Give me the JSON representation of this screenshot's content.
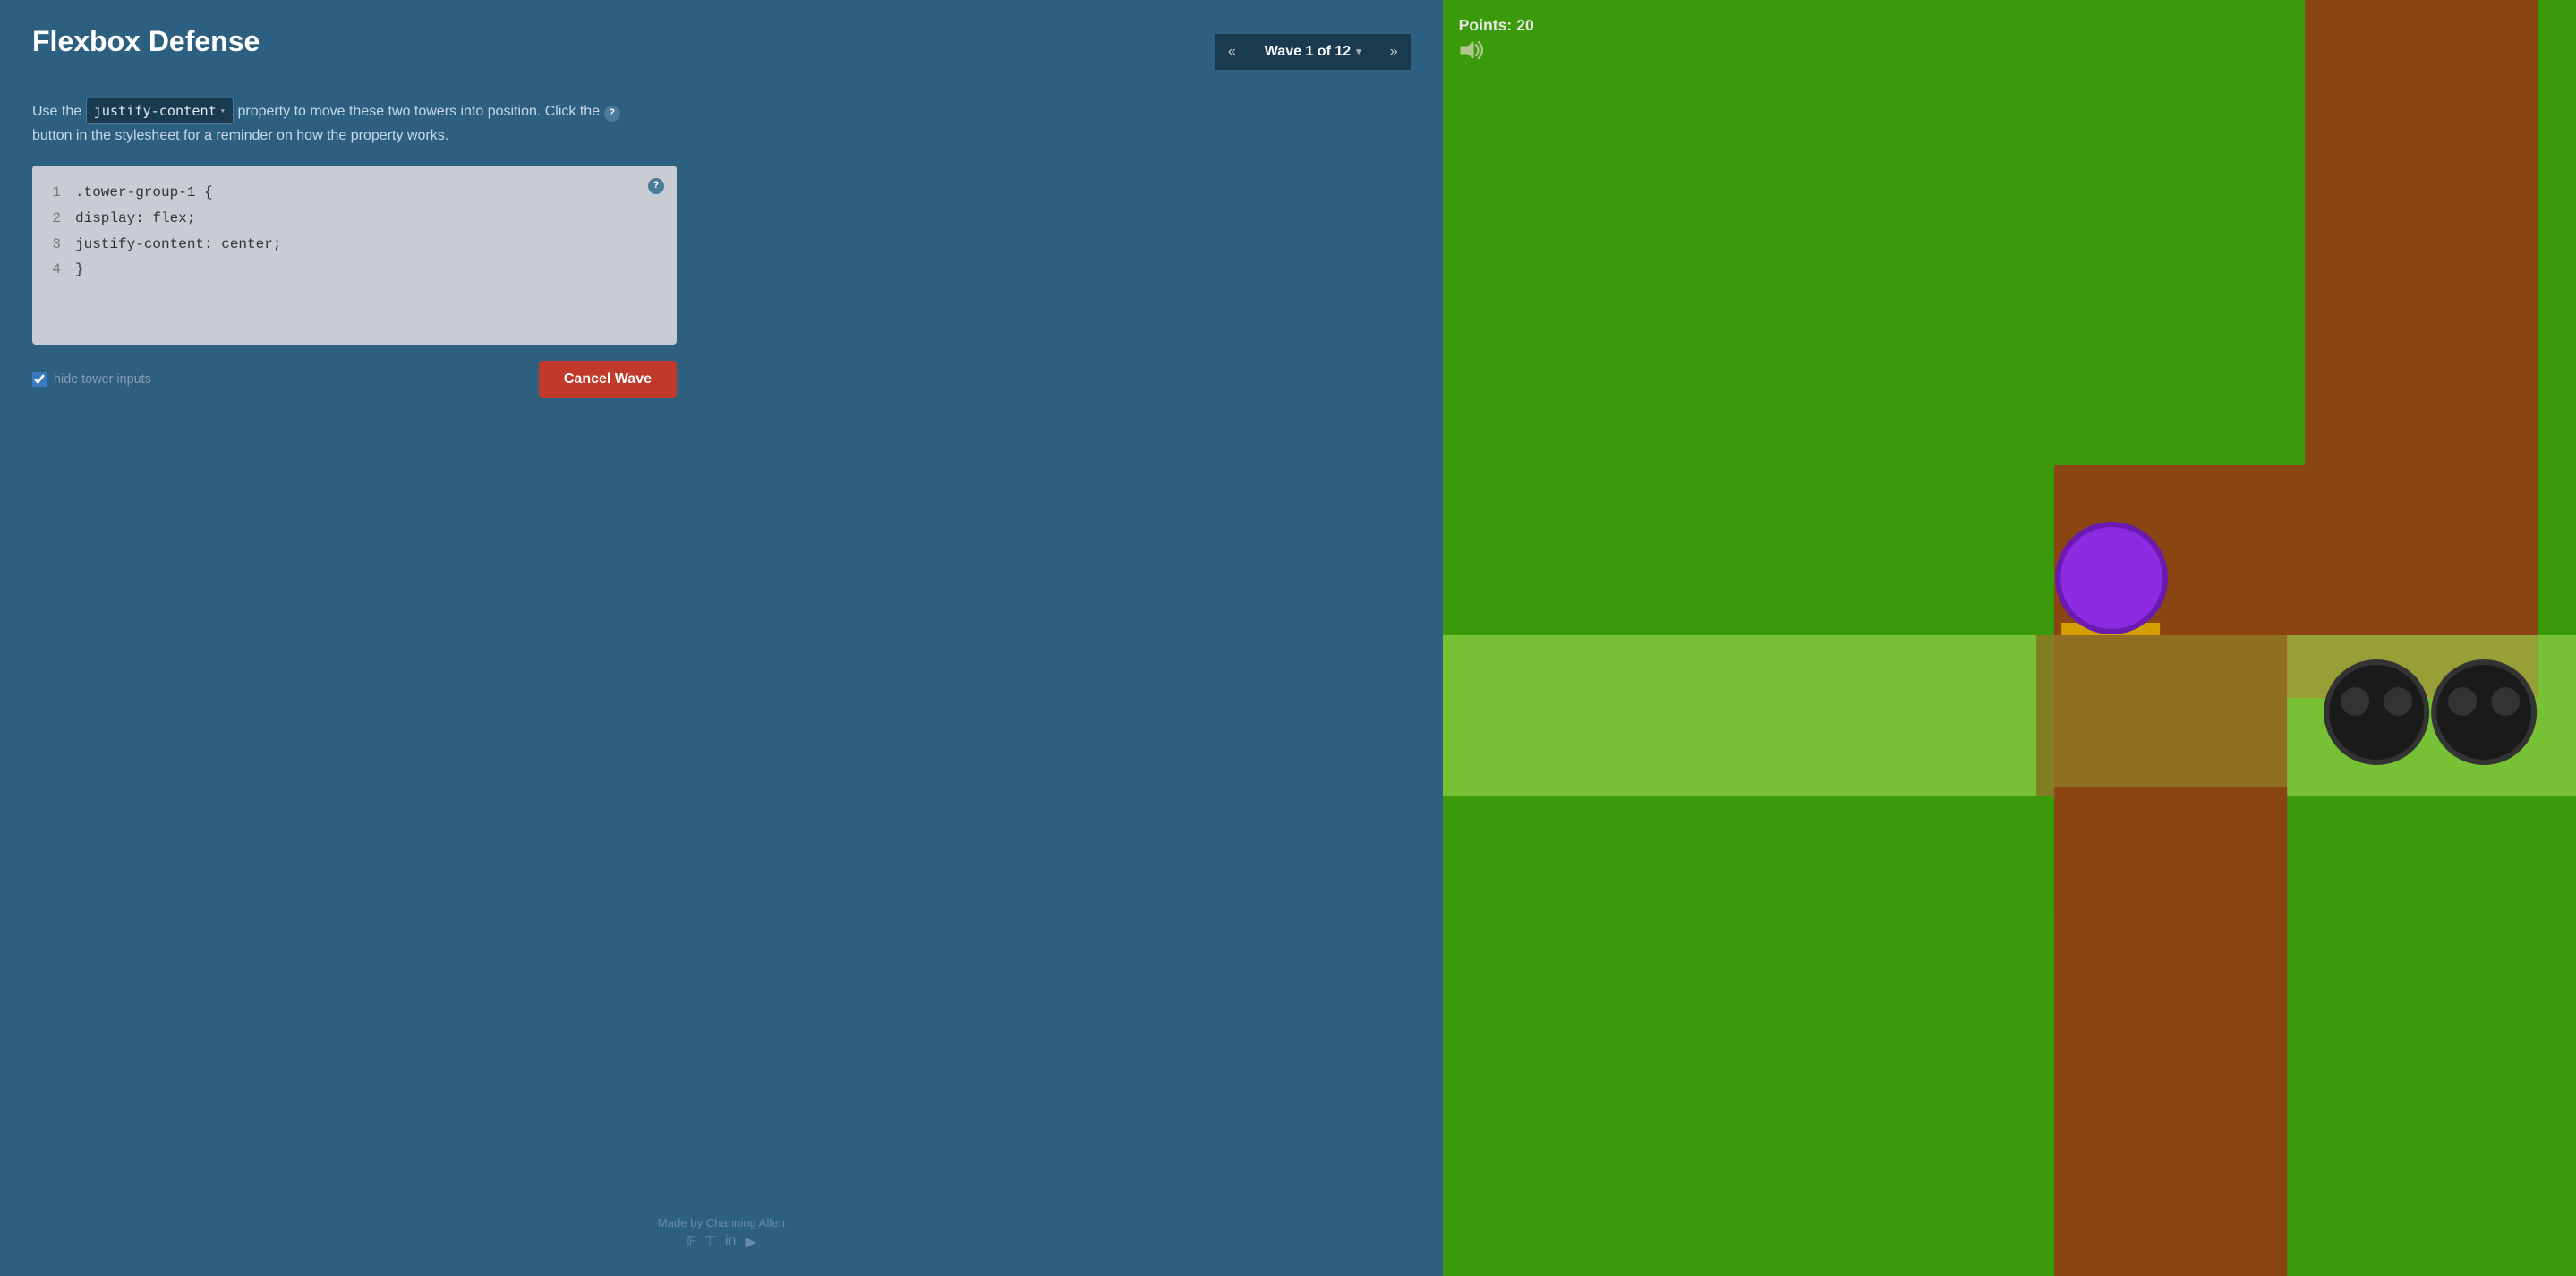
{
  "app": {
    "title": "Flexbox Defense"
  },
  "wave_nav": {
    "prev_label": "«",
    "next_label": "»",
    "wave_label": "Wave 1 of 12",
    "chevron": "▾"
  },
  "instruction": {
    "text_before": "Use the",
    "property": "justify-content",
    "text_after": "property to move these two towers into position. Click the",
    "text_end": "button in the stylesheet for a reminder on how the property works."
  },
  "code_editor": {
    "lines": [
      {
        "num": "1",
        "content": ".tower-group-1 {"
      },
      {
        "num": "2",
        "content": "    display: flex;"
      },
      {
        "num": "3",
        "content": "    justify-content: center;"
      },
      {
        "num": "4",
        "content": "}"
      }
    ],
    "help_label": "?",
    "hide_inputs_label": "hide tower inputs",
    "hide_inputs_checked": true
  },
  "buttons": {
    "cancel_wave": "Cancel Wave"
  },
  "footer": {
    "credit": "Made by Channing Allen",
    "icons": [
      "f",
      "t",
      "in",
      "gh"
    ]
  },
  "game": {
    "points_label": "Points:",
    "points_value": "20",
    "sound_icon": "🔊"
  }
}
